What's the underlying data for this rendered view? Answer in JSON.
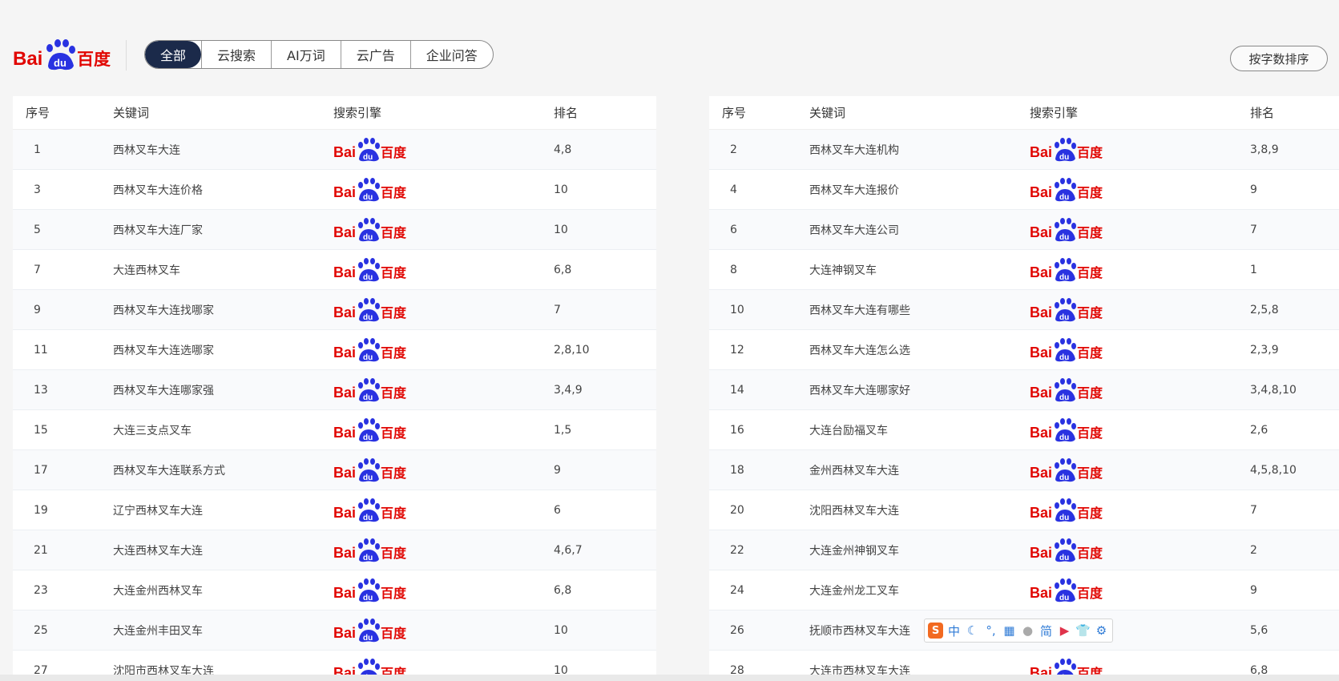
{
  "brand": {
    "logo_text_1": "Bai",
    "logo_text_2": "du",
    "logo_text_3": "百度"
  },
  "tabs": [
    {
      "label": "全部",
      "active": true
    },
    {
      "label": "云搜索",
      "active": false
    },
    {
      "label": "AI万词",
      "active": false
    },
    {
      "label": "云广告",
      "active": false
    },
    {
      "label": "企业问答",
      "active": false
    }
  ],
  "sort_button": "按字数排序",
  "columns": {
    "no": "序号",
    "keyword": "关键词",
    "engine": "搜索引擎",
    "rank": "排名"
  },
  "left_rows": [
    {
      "no": "1",
      "keyword": "西林叉车大连",
      "rank": "4,8"
    },
    {
      "no": "3",
      "keyword": "西林叉车大连价格",
      "rank": "10"
    },
    {
      "no": "5",
      "keyword": "西林叉车大连厂家",
      "rank": "10"
    },
    {
      "no": "7",
      "keyword": "大连西林叉车",
      "rank": "6,8"
    },
    {
      "no": "9",
      "keyword": "西林叉车大连找哪家",
      "rank": "7"
    },
    {
      "no": "11",
      "keyword": "西林叉车大连选哪家",
      "rank": "2,8,10"
    },
    {
      "no": "13",
      "keyword": "西林叉车大连哪家强",
      "rank": "3,4,9"
    },
    {
      "no": "15",
      "keyword": "大连三支点叉车",
      "rank": "1,5"
    },
    {
      "no": "17",
      "keyword": "西林叉车大连联系方式",
      "rank": "9"
    },
    {
      "no": "19",
      "keyword": "辽宁西林叉车大连",
      "rank": "6"
    },
    {
      "no": "21",
      "keyword": "大连西林叉车大连",
      "rank": "4,6,7"
    },
    {
      "no": "23",
      "keyword": "大连金州西林叉车",
      "rank": "6,8"
    },
    {
      "no": "25",
      "keyword": "大连金州丰田叉车",
      "rank": "10"
    },
    {
      "no": "27",
      "keyword": "沈阳市西林叉车大连",
      "rank": "10"
    }
  ],
  "right_rows": [
    {
      "no": "2",
      "keyword": "西林叉车大连机构",
      "rank": "3,8,9"
    },
    {
      "no": "4",
      "keyword": "西林叉车大连报价",
      "rank": "9"
    },
    {
      "no": "6",
      "keyword": "西林叉车大连公司",
      "rank": "7"
    },
    {
      "no": "8",
      "keyword": "大连神钢叉车",
      "rank": "1"
    },
    {
      "no": "10",
      "keyword": "西林叉车大连有哪些",
      "rank": "2,5,8"
    },
    {
      "no": "12",
      "keyword": "西林叉车大连怎么选",
      "rank": "2,3,9"
    },
    {
      "no": "14",
      "keyword": "西林叉车大连哪家好",
      "rank": "3,4,8,10"
    },
    {
      "no": "16",
      "keyword": "大连台励福叉车",
      "rank": "2,6"
    },
    {
      "no": "18",
      "keyword": "金州西林叉车大连",
      "rank": "4,5,8,10"
    },
    {
      "no": "20",
      "keyword": "沈阳西林叉车大连",
      "rank": "7"
    },
    {
      "no": "22",
      "keyword": "大连金州神钢叉车",
      "rank": "2"
    },
    {
      "no": "24",
      "keyword": "大连金州龙工叉车",
      "rank": "9"
    },
    {
      "no": "26",
      "keyword": "抚顺市西林叉车大连",
      "rank": "5,6"
    },
    {
      "no": "28",
      "keyword": "大连市西林叉车大连",
      "rank": "6,8"
    }
  ],
  "ime": {
    "lang": "中",
    "simplified": "简"
  },
  "colors": {
    "baidu_red": "#e10602",
    "baidu_blue": "#2932e1",
    "tab_active_bg": "#1b2a4a"
  }
}
